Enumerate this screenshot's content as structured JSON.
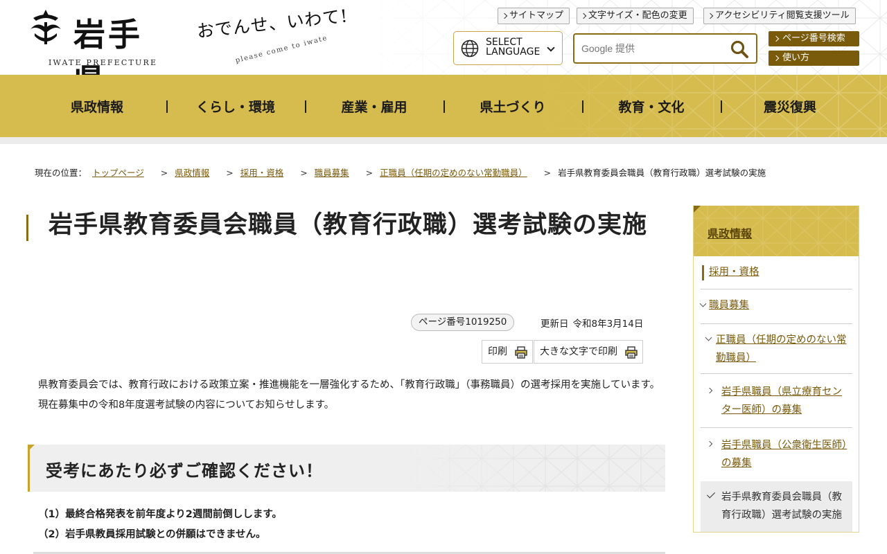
{
  "header": {
    "logo_text": "岩手県",
    "logo_en": "IWATE PREFECTURE",
    "catch": "おでんせ、いわて!",
    "catch_sub": "please come to iwate",
    "util_links": [
      "サイトマップ",
      "文字サイズ・配色の変更",
      "アクセシビリティ閲覧支援ツール"
    ],
    "language_label_1": "SELECT",
    "language_label_2": "LANGUAGE",
    "search_placeholder": "Google 提供",
    "page_search_button": "ページ番号検索",
    "usage_button": "使い方"
  },
  "gnav": [
    "県政情報",
    "くらし・環境",
    "産業・雇用",
    "県土づくり",
    "教育・文化",
    "震災復興"
  ],
  "breadcrumb": {
    "label": "現在の位置：",
    "links": [
      "トップページ",
      "県政情報",
      "採用・資格",
      "職員募集",
      "正職員（任期の定めのない常勤職員）"
    ],
    "current": "岩手県教育委員会職員（教育行政職）選考試験の実施"
  },
  "main": {
    "title": "岩手県教育委員会職員（教育行政職）選考試験の実施",
    "page_number": "ページ番号1019250",
    "updated_label": "更新日",
    "updated_date": "令和8年3月14日",
    "print_label": "印刷",
    "print_large_label": "大きな文字で印刷",
    "intro_1": "県教育委員会では、教育行政における政策立案・推進機能を一層強化するため、「教育行政職」（事務職員）の選考採用を実施しています。",
    "intro_2": "現在募集中の令和8年度選考試験の内容についてお知らせします。",
    "section_heading": "受考にあたり必ずご確認ください！",
    "notes": [
      "（1）最終合格発表を前年度より2週間前倒しします。",
      "（2）岩手県教員採用試験との併願はできません。"
    ]
  },
  "side": {
    "heading": "県政情報",
    "item_1": "採用・資格",
    "item_2": "職員募集",
    "item_3": "正職員（任期の定めのない常勤職員）",
    "item_4": "岩手県職員（県立療育センター医師）の募集",
    "item_5": "岩手県職員（公衆衛生医師）の募集",
    "item_active": "岩手県教育委員会職員（教育行政職）選考試験の実施"
  },
  "colors": {
    "gold": "#d6bc4e",
    "dark_gold": "#7a5a0b",
    "link": "#7a5a0b"
  }
}
